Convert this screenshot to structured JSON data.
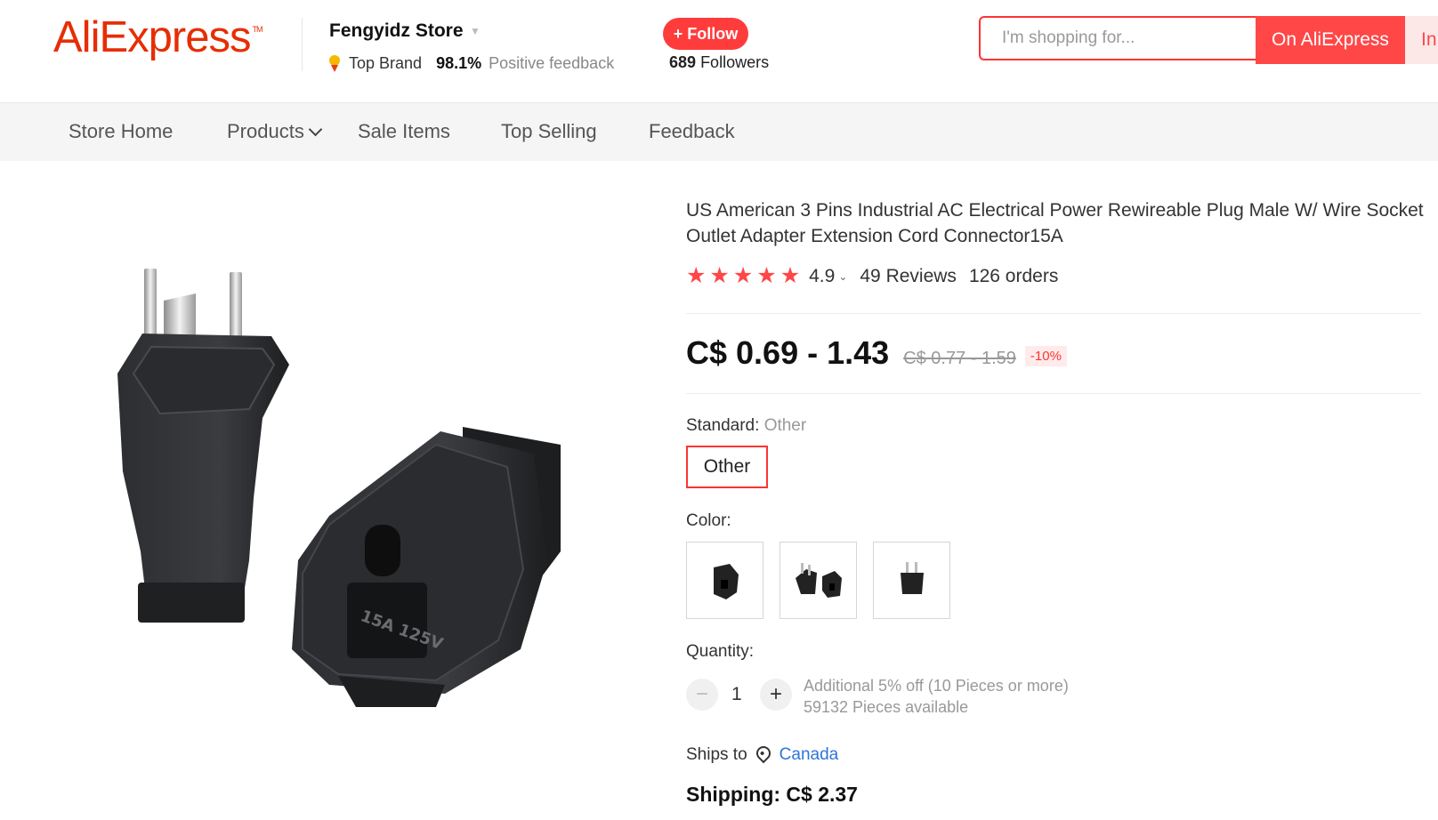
{
  "header": {
    "logo_text": "AliExpress",
    "store": {
      "name": "Fengyidz Store",
      "badge": "Top Brand",
      "feedback_percent": "98.1%",
      "feedback_label": "Positive feedback"
    },
    "follow_label": "+ Follow",
    "followers_count": "689",
    "followers_label": "Followers",
    "search": {
      "placeholder": "I'm shopping for...",
      "button_aliexpress": "On AliExpress",
      "button_store": "In this store"
    }
  },
  "nav": {
    "items": [
      "Store Home",
      "Products",
      "Sale Items",
      "Top Selling",
      "Feedback"
    ]
  },
  "product": {
    "title": "US American 3 Pins Industrial AC Electrical Power Rewireable Plug Male W/ Wire Socket Outlet Adapter Extension Cord Connector15A",
    "rating": "4.9",
    "stars": 5,
    "reviews": "49 Reviews",
    "orders": "126 orders",
    "price": "C$ 0.69 - 1.43",
    "original_price": "C$ 0.77 - 1.59",
    "discount": "-10%",
    "standard_label": "Standard:",
    "standard_value": "Other",
    "standard_option": "Other",
    "color_label": "Color:",
    "color_options": [
      "socket-female",
      "plug-and-socket-pair",
      "plug-male"
    ],
    "quantity_label": "Quantity:",
    "quantity": "1",
    "bulk_offer": "Additional 5% off (10 Pieces or more)",
    "available": "59132 Pieces available",
    "ships_to_label": "Ships to",
    "ships_to_country": "Canada",
    "shipping": "Shipping: C$ 2.37",
    "image_print": "15A 125V"
  },
  "colors": {
    "brand": "#e62e04",
    "accent": "#ff4747",
    "link": "#2f75d9"
  }
}
